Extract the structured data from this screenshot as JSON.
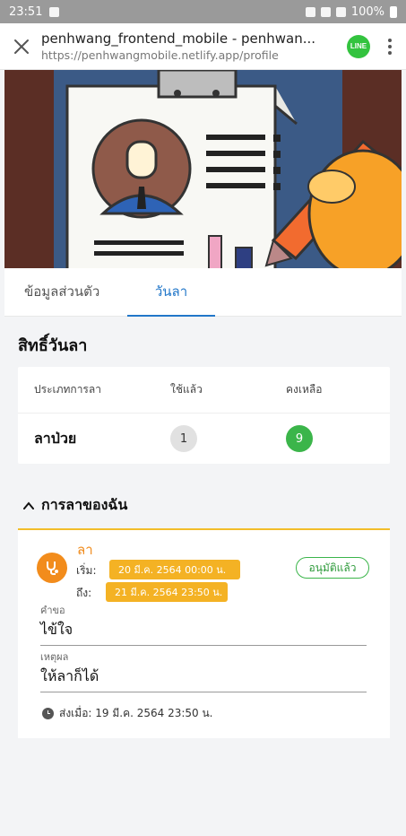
{
  "status_bar": {
    "time": "23:51",
    "battery": "100%"
  },
  "browser": {
    "title": "penhwang_frontend_mobile - penhwan...",
    "url": "https://penhwangmobile.netlify.app/profile",
    "share_label": "LINE"
  },
  "tabs": [
    {
      "label": "ข้อมูลส่วนตัว"
    },
    {
      "label": "วันลา"
    }
  ],
  "quota": {
    "title": "สิทธิ์วันลา",
    "headers": [
      "ประเภทการลา",
      "ใช้แล้ว",
      "คงเหลือ"
    ],
    "rows": [
      {
        "type": "ลาป่วย",
        "used": "1",
        "remaining": "9"
      }
    ]
  },
  "my_leaves": {
    "title": "การลาของฉัน",
    "items": [
      {
        "type": "ลา",
        "start_label": "เริ่ม:",
        "start": "20 มี.ค. 2564 00:00 น.",
        "end_label": "ถึง:",
        "end": "21 มี.ค. 2564 23:50 น.",
        "status": "อนุมัติแล้ว",
        "request_label": "คำขอ",
        "request": "ไข้ใจ",
        "reason_label": "เหตุผล",
        "reason": "ให้ลาก็ได้",
        "sent": "ส่งเมื่อ: 19 มี.ค. 2564 23:50 น."
      }
    ]
  },
  "colors": {
    "accent": "#2277c9",
    "warning": "#f4b224",
    "success": "#3bb54a",
    "leave_icon": "#f28c1c"
  }
}
